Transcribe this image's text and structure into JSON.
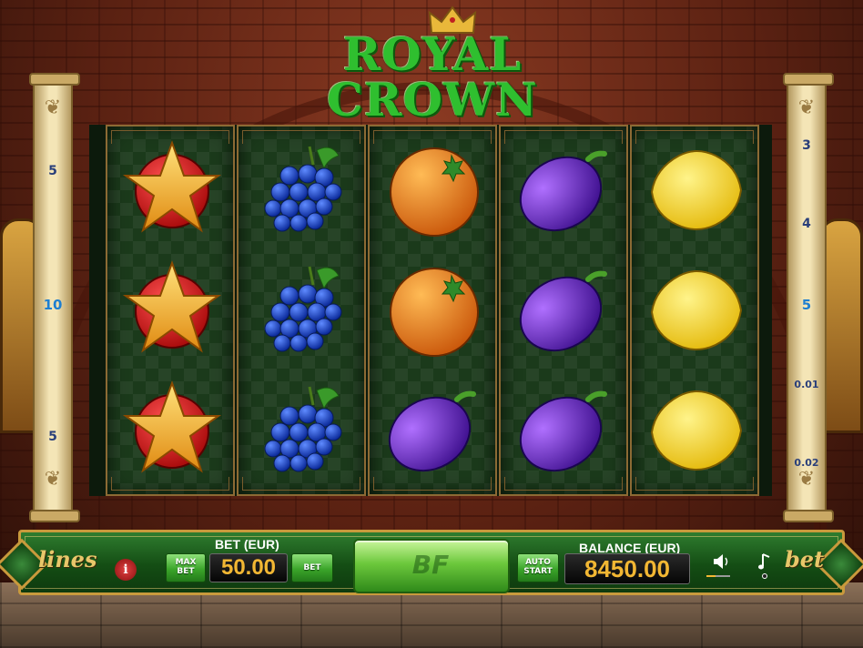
{
  "game": {
    "title_line1": "ROYAL",
    "title_line2": "CROWN"
  },
  "paytable_left": {
    "values": [
      "5",
      "10",
      "5"
    ],
    "highlight_index": 1
  },
  "paytable_right": {
    "values": [
      "3",
      "4",
      "5",
      "0.01",
      "0.02"
    ]
  },
  "reels": [
    [
      "star",
      "star",
      "star"
    ],
    [
      "grapes",
      "grapes",
      "grapes"
    ],
    [
      "orange",
      "orange",
      "plum"
    ],
    [
      "plum",
      "plum",
      "plum"
    ],
    [
      "lemon",
      "lemon",
      "lemon"
    ]
  ],
  "controls": {
    "lines_label": "lines",
    "bet_word_label": "bet",
    "info_label": "i",
    "max_bet_label_1": "MAX",
    "max_bet_label_2": "BET",
    "bet_title": "BET (EUR)",
    "bet_value": "50.00",
    "bet_button_label": "BET",
    "spin_logo": "BF",
    "auto_start_label_1": "AUTO",
    "auto_start_label_2": "START",
    "balance_title": "BALANCE (EUR)",
    "balance_value": "8450.00",
    "volume_icon": "speaker-icon",
    "music_icon": "music-note-icon"
  },
  "colors": {
    "title_green": "#2fbf2f",
    "value_gold": "#f2b733",
    "button_green": "#3ba52a",
    "frame_gold": "#c99a3c"
  }
}
